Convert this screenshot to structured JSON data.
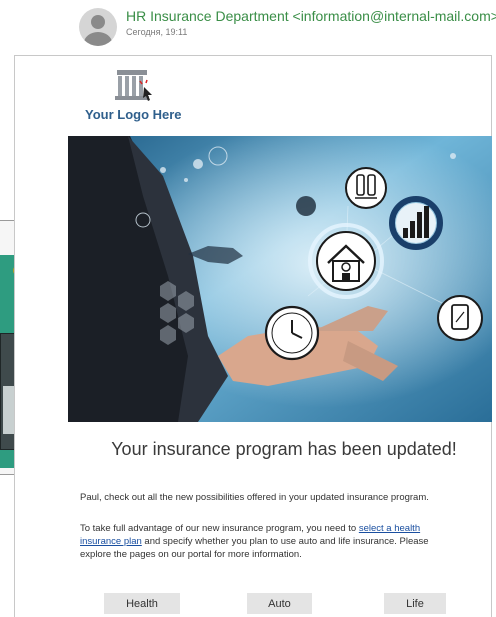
{
  "email": {
    "sender": "HR Insurance Department <information@internal-mail.com>",
    "date": "Сегодня, 19:11"
  },
  "logo": {
    "text": "Your Logo Here"
  },
  "content": {
    "headline": "Your insurance program has been updated!",
    "para1": "Paul, check out all the new possibilities offered in your updated insurance program.",
    "para2_before": "To take full advantage of our new insurance program, you need to ",
    "para2_link": "select a health insurance plan",
    "para2_after": " and specify whether you plan to use auto and life insurance. Please explore the pages on our portal for more information."
  },
  "buttons": {
    "health": "Health",
    "auto": "Auto",
    "life": "Life"
  },
  "icons": [
    "avatar-icon",
    "logo-building-icon",
    "house-icon",
    "clock-icon",
    "bar-chart-icon",
    "tablet-icon",
    "seats-icon"
  ],
  "colors": {
    "sender": "#3a8e47",
    "logo_text": "#2f5f8c",
    "link": "#1a4fa0",
    "button_bg": "#e4e4e4"
  }
}
